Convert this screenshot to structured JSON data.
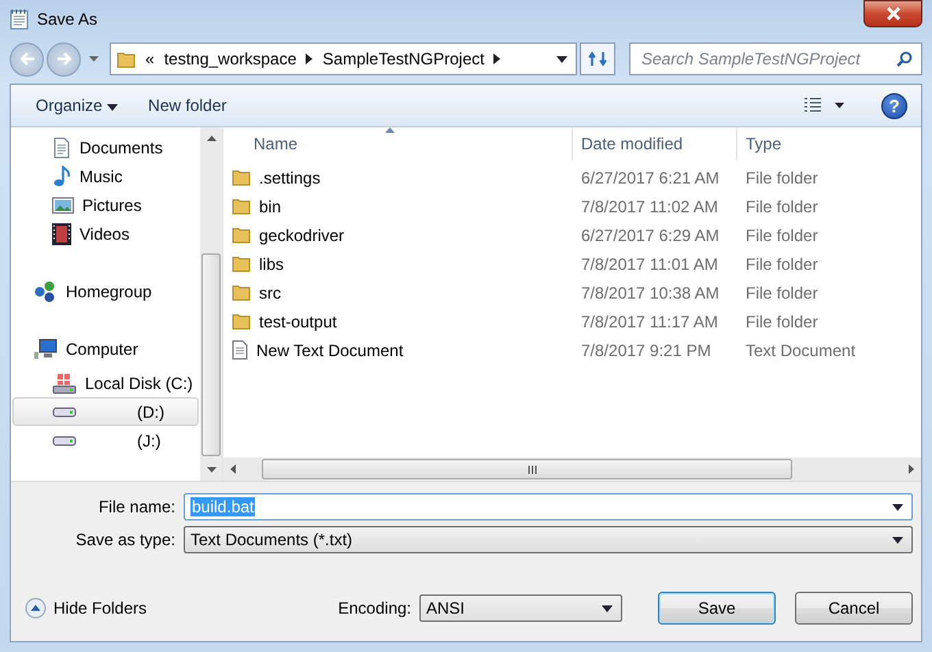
{
  "window": {
    "title": "Save As"
  },
  "address_bar": {
    "overflow": "«",
    "crumbs": [
      "testng_workspace",
      "SampleTestNGProject"
    ]
  },
  "search": {
    "placeholder": "Search SampleTestNGProject"
  },
  "toolbar": {
    "organize": "Organize",
    "new_folder": "New folder",
    "help": "?"
  },
  "nav_pane": [
    {
      "children": [
        {
          "label": "Documents",
          "kind": "documents",
          "selected": false
        },
        {
          "label": "Music",
          "kind": "music",
          "selected": false
        },
        {
          "label": "Pictures",
          "kind": "pictures",
          "selected": false
        },
        {
          "label": "Videos",
          "kind": "videos",
          "selected": false
        }
      ]
    },
    {
      "label": "Homegroup",
      "kind": "homegroup",
      "selected": false
    },
    {
      "label": "Computer",
      "kind": "computer",
      "selected": false,
      "children": [
        {
          "label": "Local Disk (C:)",
          "kind": "system-disk",
          "selected": false
        },
        {
          "label": "(D:)",
          "kind": "drive",
          "selected": true
        },
        {
          "label": "(J:)",
          "kind": "drive",
          "selected": false
        }
      ]
    }
  ],
  "table": {
    "columns": [
      "Name",
      "Date modified",
      "Type"
    ],
    "rows": [
      {
        "kind": "folder",
        "name": ".settings",
        "date": "6/27/2017 6:21 AM",
        "type": "File folder"
      },
      {
        "kind": "folder",
        "name": "bin",
        "date": "7/8/2017 11:02 AM",
        "type": "File folder"
      },
      {
        "kind": "folder",
        "name": "geckodriver",
        "date": "6/27/2017 6:29 AM",
        "type": "File folder"
      },
      {
        "kind": "folder",
        "name": "libs",
        "date": "7/8/2017 11:01 AM",
        "type": "File folder"
      },
      {
        "kind": "folder",
        "name": "src",
        "date": "7/8/2017 10:38 AM",
        "type": "File folder"
      },
      {
        "kind": "folder",
        "name": "test-output",
        "date": "7/8/2017 11:17 AM",
        "type": "File folder"
      },
      {
        "kind": "text",
        "name": "New Text Document",
        "date": "7/8/2017 9:21 PM",
        "type": "Text Document"
      }
    ]
  },
  "file_name": {
    "label": "File name:",
    "value": "build.bat"
  },
  "save_as_type": {
    "label": "Save as type:",
    "value": "Text Documents (*.txt)"
  },
  "hide_folders": "Hide Folders",
  "encoding": {
    "label": "Encoding:",
    "value": "ANSI"
  },
  "buttons": [
    "Save",
    "Cancel"
  ]
}
